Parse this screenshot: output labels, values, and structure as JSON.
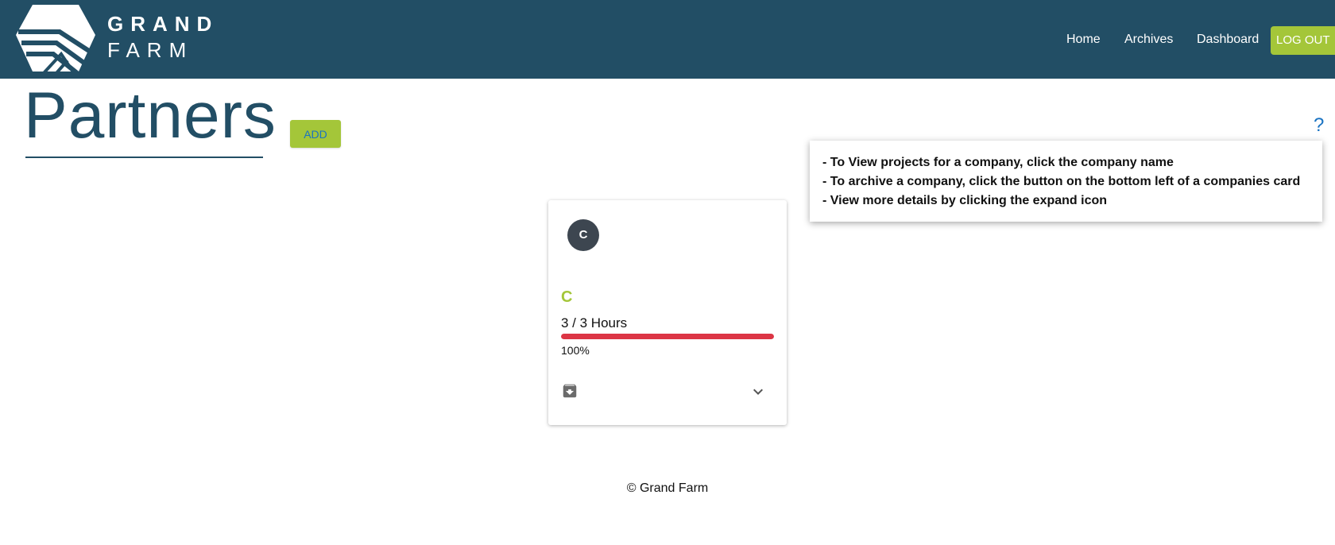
{
  "brand": {
    "line1": "GRAND",
    "line2": "FARM",
    "logo_icon": "grand-farm-logo-icon",
    "header_color": "#224e65",
    "accent_color": "#a4c639"
  },
  "nav": {
    "home": "Home",
    "archives": "Archives",
    "dashboard": "Dashboard",
    "logout": "LOG OUT"
  },
  "page": {
    "title": "Partners",
    "add_label": "ADD",
    "help_label": "?"
  },
  "help_tips": [
    "- To View projects for a company, click the company name",
    "- To archive a company, click the button on the bottom left of a companies card",
    "- View more details by clicking the expand icon"
  ],
  "partners": [
    {
      "avatar_letter": "C",
      "name": "C",
      "hours_text": "3 / 3 Hours",
      "progress_fraction": 1.0,
      "progress_color": "#dc3545",
      "percent_text": "100%",
      "archive_icon": "archive-icon",
      "expand_icon": "chevron-down-icon"
    }
  ],
  "footer": {
    "text": "© Grand Farm"
  }
}
